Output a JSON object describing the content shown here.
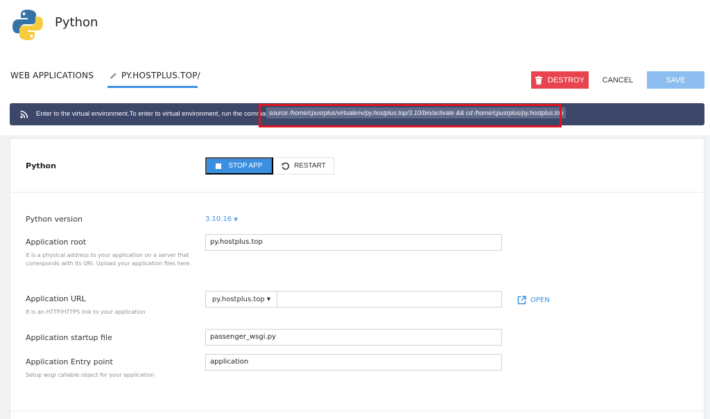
{
  "header": {
    "app_title": "Python"
  },
  "breadcrumb": {
    "web_applications": "WEB APPLICATIONS",
    "domain": "PY.HOSTPLUS.TOP/"
  },
  "toolbar": {
    "destroy_label": "DESTROY",
    "cancel_label": "CANCEL",
    "save_label": "SAVE"
  },
  "notice": {
    "text": "Enter to the virtual environment.To enter to virtual environment, run the command:",
    "command": "source /home/cpusrplus/virtualenv/py.hostplus.top/3.10/bin/activate && cd /home/cpusrplus/py.hostplus.top"
  },
  "app_panel": {
    "title": "Python",
    "stop_label": "STOP APP",
    "restart_label": "RESTART"
  },
  "form": {
    "python_version": {
      "label": "Python version",
      "value": "3.10.16"
    },
    "app_root": {
      "label": "Application root",
      "value": "py.hostplus.top",
      "help": "It is a physical address to your application on a server that corresponds with its URI. Upload your application files here."
    },
    "app_url": {
      "label": "Application URL",
      "domain": "py.hostplus.top",
      "path": "",
      "help": "It is an HTTP/HTTPS link to your application",
      "open_label": "OPEN"
    },
    "startup_file": {
      "label": "Application startup file",
      "value": "passenger_wsgi.py"
    },
    "entry_point": {
      "label": "Application Entry point",
      "value": "application",
      "help": "Setup wsgi callable object for your application"
    }
  }
}
